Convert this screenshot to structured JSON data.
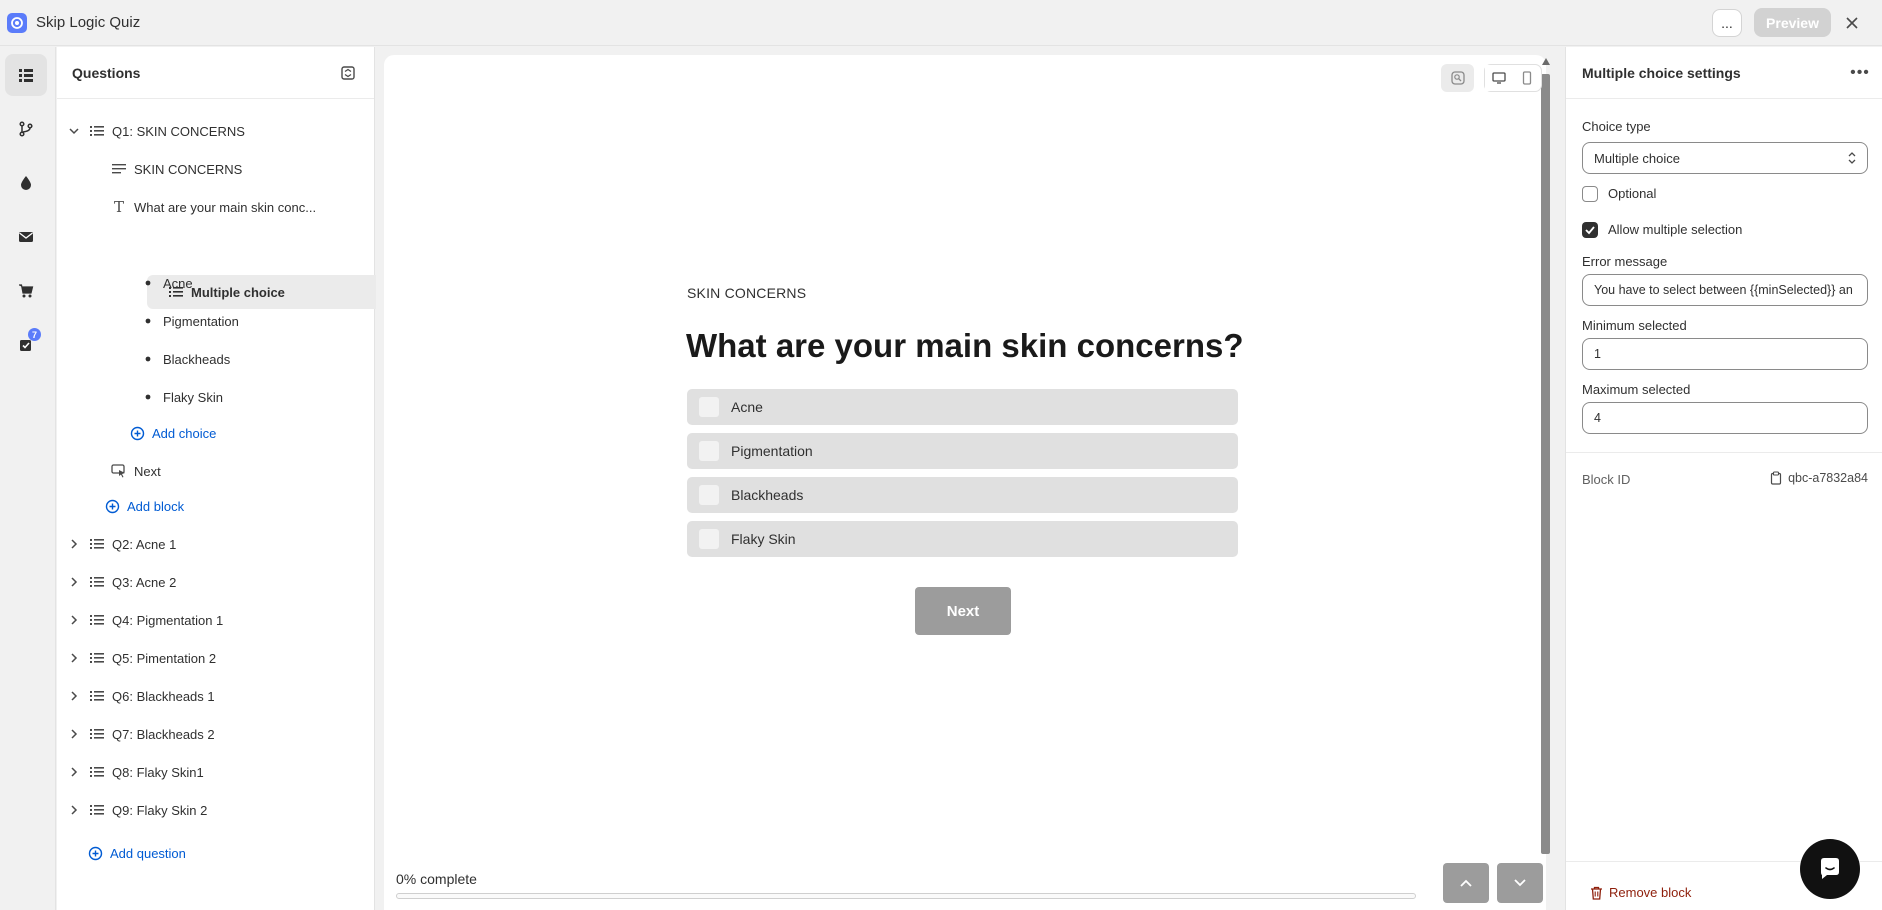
{
  "app": {
    "title": "Skip Logic Quiz"
  },
  "topbar": {
    "more_label": "...",
    "preview_label": "Preview"
  },
  "rail": {
    "badge_count": "7"
  },
  "tree": {
    "title": "Questions",
    "q1": {
      "label": "Q1: SKIN CONCERNS",
      "blocks": {
        "heading": "SKIN CONCERNS",
        "text": "What are your main skin conc...",
        "choice_block": "Multiple choice",
        "choices": [
          "Acne",
          "Pigmentation",
          "Blackheads",
          "Flaky Skin"
        ],
        "add_choice": "Add choice",
        "next": "Next",
        "add_block": "Add block"
      }
    },
    "questions": [
      "Q2: Acne 1",
      "Q3: Acne 2",
      "Q4: Pigmentation 1",
      "Q5: Pimentation 2",
      "Q6: Blackheads 1",
      "Q7: Blackheads 2",
      "Q8: Flaky Skin1",
      "Q9: Flaky Skin 2"
    ],
    "add_question": "Add question"
  },
  "preview": {
    "label": "SKIN CONCERNS",
    "title": "What are your main skin concerns?",
    "choices": [
      "Acne",
      "Pigmentation",
      "Blackheads",
      "Flaky Skin"
    ],
    "next_label": "Next",
    "progress_text": "0% complete",
    "progress_value": 0
  },
  "settings": {
    "title": "Multiple choice settings",
    "choice_type_label": "Choice type",
    "choice_type_value": "Multiple choice",
    "optional_label": "Optional",
    "optional_checked": false,
    "allow_multiple_label": "Allow multiple selection",
    "allow_multiple_checked": true,
    "error_message_label": "Error message",
    "error_message_value": "You have to select between {{minSelected}} an",
    "min_label": "Minimum selected",
    "min_value": "1",
    "max_label": "Maximum selected",
    "max_value": "4",
    "block_id_label": "Block ID",
    "block_id_value": "qbc-a7832a84",
    "remove_label": "Remove block"
  },
  "colors": {
    "accent": "#005bd3",
    "brand": "#5b7cfa",
    "danger": "#8e1f0b"
  }
}
